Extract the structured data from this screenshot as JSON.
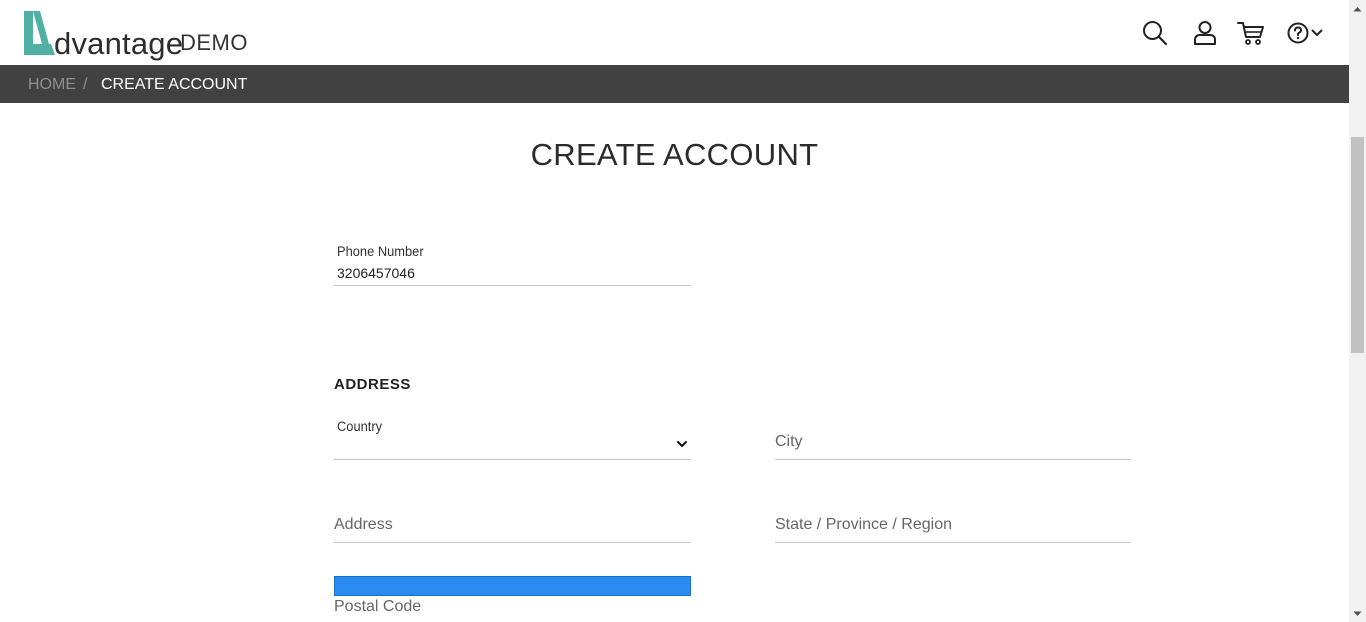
{
  "brand": {
    "word": "dvantage",
    "suffix": "DEMO",
    "accent_color": "#4fb0a3"
  },
  "header_icons": [
    "search-icon",
    "user-icon",
    "cart-icon",
    "help-icon",
    "chevron-down-icon"
  ],
  "breadcrumb": {
    "home": "HOME",
    "separator": "/",
    "current": "CREATE ACCOUNT"
  },
  "page": {
    "title": "CREATE ACCOUNT"
  },
  "form": {
    "phone": {
      "label": "Phone Number",
      "value": "3206457046"
    },
    "address_section": {
      "title": "ADDRESS"
    },
    "country": {
      "label": "Country",
      "value": ""
    },
    "city": {
      "placeholder": "City"
    },
    "address": {
      "placeholder": "Address"
    },
    "state": {
      "placeholder": "State / Province / Region"
    },
    "postal_code": {
      "placeholder": "Postal Code"
    }
  },
  "colors": {
    "breadcrumb_bg": "#414141",
    "highlight": "#2a8cf0"
  }
}
